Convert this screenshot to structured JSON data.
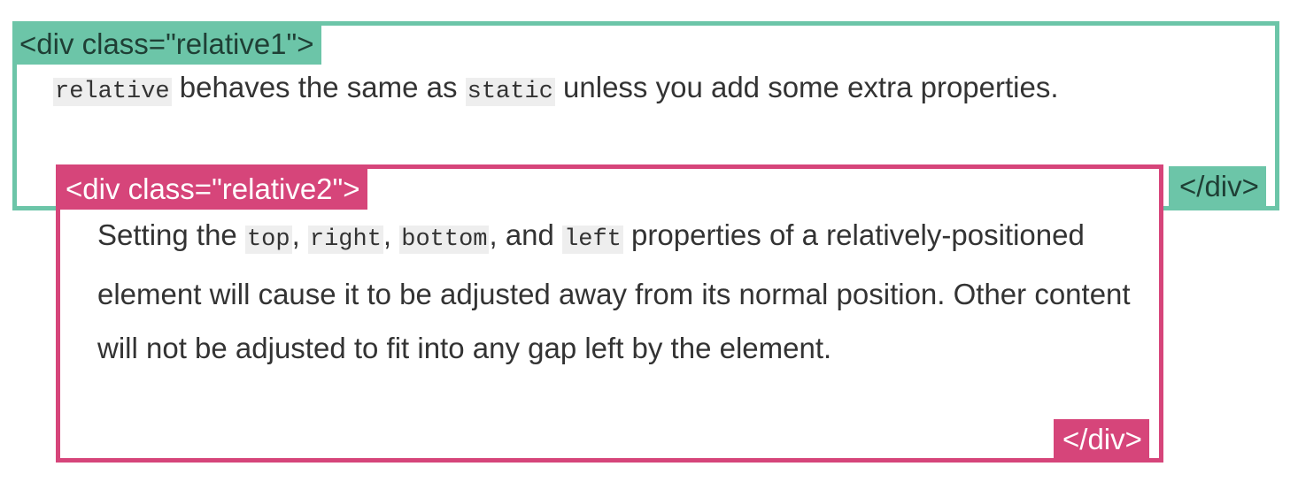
{
  "relative1": {
    "open_tag": "<div class=\"relative1\">",
    "close_tag": "</div>",
    "text": {
      "code1": "relative",
      "t1": " behaves the same as ",
      "code2": "static",
      "t2": " unless you add some extra properties."
    }
  },
  "relative2": {
    "open_tag": "<div class=\"relative2\">",
    "close_tag": "</div>",
    "text": {
      "t0": "Setting the ",
      "code_top": "top",
      "sep1": ", ",
      "code_right": "right",
      "sep2": ", ",
      "code_bottom": "bottom",
      "sep3": ", and ",
      "code_left": "left",
      "t1": " properties of a relatively-positioned element will cause it to be adjusted away from its normal position. Other content will not be adjusted to fit into any gap left by the element."
    }
  },
  "colors": {
    "green": "#6cc5a8",
    "pink": "#d6457a",
    "text": "#333333",
    "code_bg": "#eeeeee"
  }
}
